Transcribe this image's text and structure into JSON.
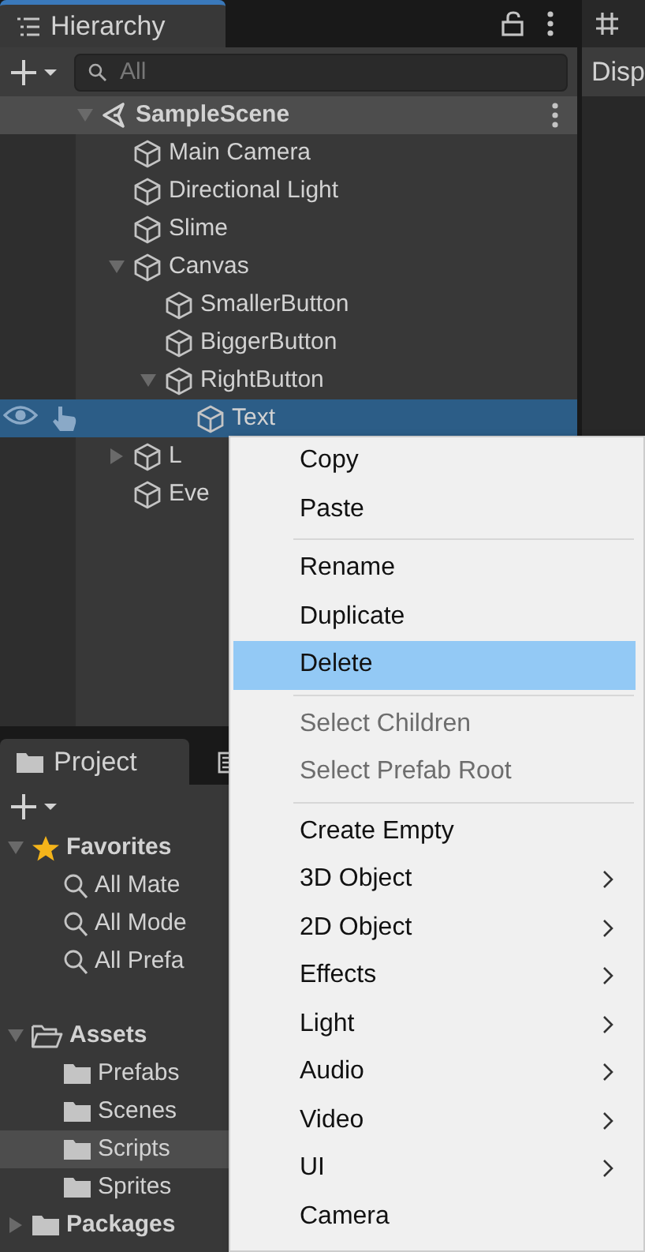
{
  "hierarchy": {
    "tab": "Hierarchy",
    "search": {
      "placeholder": "All"
    },
    "items": [
      {
        "name": "SampleScene",
        "kind": "scene",
        "expanded": true,
        "selected": false,
        "children": [
          {
            "name": "Main Camera",
            "kind": "object",
            "selected": false
          },
          {
            "name": "Directional Light",
            "kind": "object",
            "selected": false
          },
          {
            "name": "Slime",
            "kind": "object",
            "selected": false
          },
          {
            "name": "Canvas",
            "kind": "object",
            "expanded": true,
            "selected": false,
            "children": [
              {
                "name": "SmallerButton",
                "kind": "object",
                "selected": false
              },
              {
                "name": "BiggerButton",
                "kind": "object",
                "selected": false
              },
              {
                "name": "RightButton",
                "kind": "object",
                "expanded": true,
                "selected": false,
                "children": [
                  {
                    "name": "Text",
                    "kind": "object",
                    "selected": true
                  }
                ]
              }
            ]
          },
          {
            "name": "L",
            "kind": "object",
            "expanded": false,
            "selected": false
          },
          {
            "name": "Eve",
            "kind": "object",
            "selected": false
          }
        ]
      }
    ]
  },
  "side_panel": {
    "label": "Disp"
  },
  "project": {
    "tab": "Project",
    "items": [
      {
        "name": "Favorites",
        "kind": "favorites",
        "expanded": true,
        "selected": false,
        "children": [
          {
            "name": "All Mate",
            "kind": "search",
            "selected": false
          },
          {
            "name": "All Mode",
            "kind": "search",
            "selected": false
          },
          {
            "name": "All Prefa",
            "kind": "search",
            "selected": false
          }
        ]
      },
      {
        "name": "Assets",
        "kind": "folder-open",
        "expanded": true,
        "selected": false,
        "children": [
          {
            "name": "Prefabs",
            "kind": "folder",
            "selected": false
          },
          {
            "name": "Scenes",
            "kind": "folder",
            "selected": false
          },
          {
            "name": "Scripts",
            "kind": "folder",
            "selected": true
          },
          {
            "name": "Sprites",
            "kind": "folder",
            "selected": false
          }
        ]
      },
      {
        "name": "Packages",
        "kind": "folder",
        "expanded": false,
        "selected": false
      }
    ]
  },
  "context_menu": [
    {
      "kind": "item",
      "label": "Copy",
      "disabled": false,
      "selected": false,
      "submenu": false
    },
    {
      "kind": "item",
      "label": "Paste",
      "disabled": false,
      "selected": false,
      "submenu": false
    },
    {
      "kind": "separator"
    },
    {
      "kind": "item",
      "label": "Rename",
      "disabled": false,
      "selected": false,
      "submenu": false
    },
    {
      "kind": "item",
      "label": "Duplicate",
      "disabled": false,
      "selected": false,
      "submenu": false
    },
    {
      "kind": "item",
      "label": "Delete",
      "disabled": false,
      "selected": true,
      "submenu": false
    },
    {
      "kind": "separator"
    },
    {
      "kind": "item",
      "label": "Select Children",
      "disabled": true,
      "selected": false,
      "submenu": false
    },
    {
      "kind": "item",
      "label": "Select Prefab Root",
      "disabled": true,
      "selected": false,
      "submenu": false
    },
    {
      "kind": "separator"
    },
    {
      "kind": "item",
      "label": "Create Empty",
      "disabled": false,
      "selected": false,
      "submenu": false
    },
    {
      "kind": "item",
      "label": "3D Object",
      "disabled": false,
      "selected": false,
      "submenu": true
    },
    {
      "kind": "item",
      "label": "2D Object",
      "disabled": false,
      "selected": false,
      "submenu": true
    },
    {
      "kind": "item",
      "label": "Effects",
      "disabled": false,
      "selected": false,
      "submenu": true
    },
    {
      "kind": "item",
      "label": "Light",
      "disabled": false,
      "selected": false,
      "submenu": true
    },
    {
      "kind": "item",
      "label": "Audio",
      "disabled": false,
      "selected": false,
      "submenu": true
    },
    {
      "kind": "item",
      "label": "Video",
      "disabled": false,
      "selected": false,
      "submenu": true
    },
    {
      "kind": "item",
      "label": "UI",
      "disabled": false,
      "selected": false,
      "submenu": true
    },
    {
      "kind": "item",
      "label": "Camera",
      "disabled": false,
      "selected": false,
      "submenu": false
    }
  ]
}
